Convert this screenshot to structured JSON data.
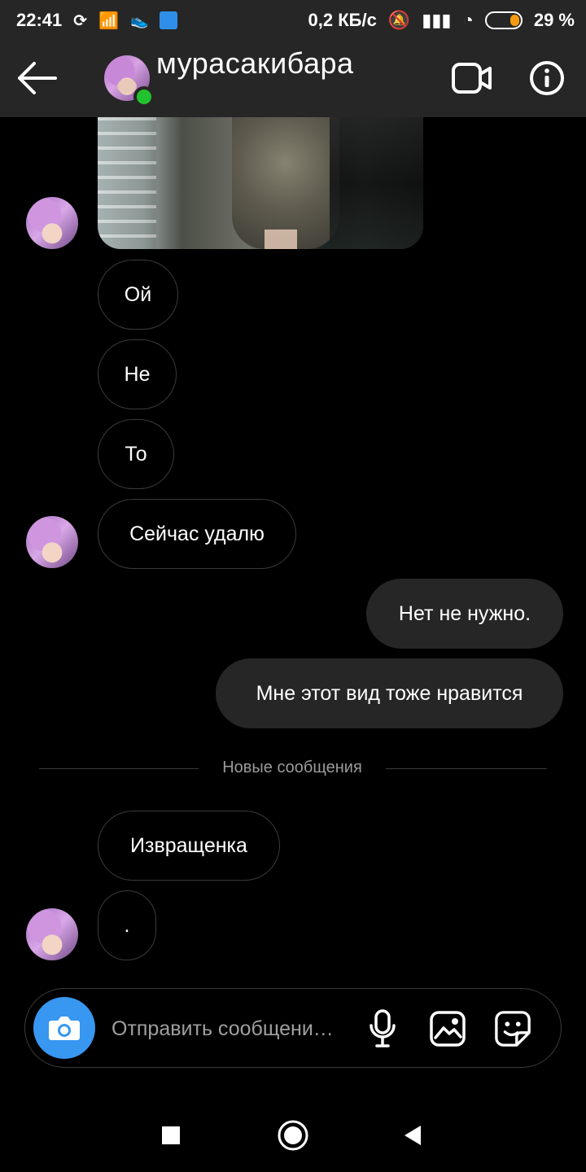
{
  "status_bar": {
    "time": "22:41",
    "network_speed": "0,2 КБ/с",
    "battery_percent": "29 %",
    "signal_icon": "signal-bars-icon",
    "wifi_icon": "wifi-icon",
    "battery_level": 29
  },
  "header": {
    "username": "мурасакибара"
  },
  "messages": [
    {
      "side": "incoming",
      "text": "Ой"
    },
    {
      "side": "incoming",
      "text": "Не"
    },
    {
      "side": "incoming",
      "text": "То"
    },
    {
      "side": "incoming",
      "text": "Сейчас удалю"
    },
    {
      "side": "outgoing",
      "text": "Нет не нужно."
    },
    {
      "side": "outgoing",
      "text": "Мне этот вид тоже нравится"
    },
    {
      "side": "incoming",
      "text": "Извращенка"
    },
    {
      "side": "incoming",
      "text": "."
    }
  ],
  "divider": {
    "text": "Новые сообщения"
  },
  "composer": {
    "placeholder": "Отправить сообщени…"
  },
  "colors": {
    "background": "#000000",
    "header_background": "#262626",
    "bubble_outgoing": "#262626",
    "bubble_border": "#3b3b3b",
    "camera_button": "#3897f0",
    "online_indicator": "#21c22d"
  }
}
